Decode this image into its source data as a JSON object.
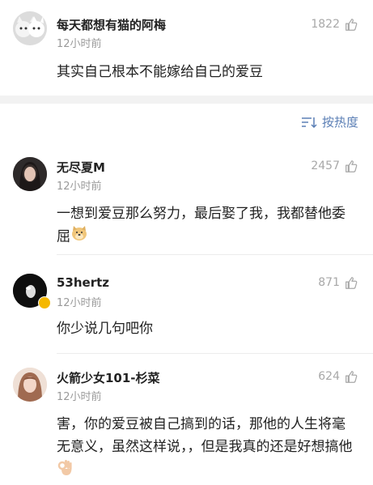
{
  "top_comment": {
    "username": "每天都想有猫的阿梅",
    "time": "12小时前",
    "likes": "1822",
    "text": "其实自己根本不能嫁给自己的爱豆"
  },
  "sort": {
    "label": "按热度"
  },
  "comments": [
    {
      "username": "无尽夏M",
      "time": "12小时前",
      "likes": "2457",
      "text": "一想到爱豆那么努力，最后娶了我，我都替他委屈"
    },
    {
      "username": "53hertz",
      "time": "12小时前",
      "likes": "871",
      "text": "你少说几句吧你"
    },
    {
      "username": "火箭少女101-杉菜",
      "time": "12小时前",
      "likes": "624",
      "text": "害，你的爱豆被自己搞到的话，那他的人生将毫无意义，虽然这样说，，但是我真的还是好想搞他"
    }
  ],
  "icons": {
    "like": "thumbs-up-icon",
    "sort": "sort-icon",
    "emoji_doge": "doge-emoji-icon",
    "emoji_ok": "ok-hand-emoji-icon",
    "verified": "verified-badge-icon"
  },
  "colors": {
    "link": "#5b7fb5",
    "meta": "#9a9a9a",
    "divider": "#ececec"
  }
}
